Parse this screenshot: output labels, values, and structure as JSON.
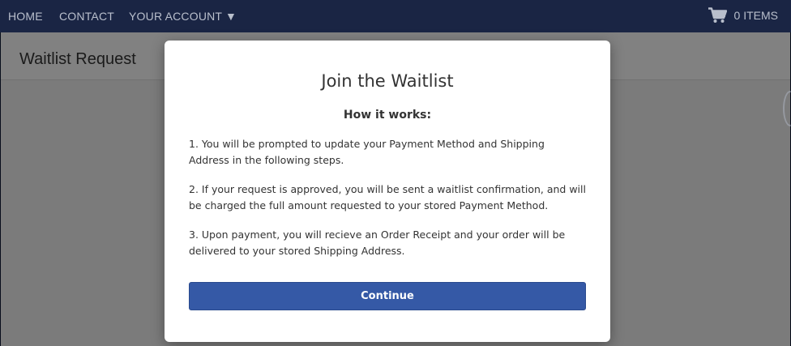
{
  "nav": {
    "home": "HOME",
    "contact": "CONTACT",
    "account": "YOUR ACCOUNT ▼",
    "cart_label": "0 ITEMS",
    "cart_icon": "shopping-cart-icon"
  },
  "page": {
    "title": "Waitlist Request"
  },
  "modal": {
    "title": "Join the Waitlist",
    "subtitle": "How it works:",
    "steps": [
      "1. You will be prompted to update your Payment Method and Shipping Address in the following steps.",
      "2. If your request is approved, you will be sent a waitlist confirmation, and will be charged the full amount requested to your stored Payment Method.",
      "3. Upon payment, you will recieve an Order Receipt and your order will be delivered to your stored Shipping Address."
    ],
    "continue_label": "Continue"
  },
  "colors": {
    "nav_bg": "#1a2544",
    "nav_text": "#b9bfcc",
    "button_bg": "#3559a6",
    "modal_bg": "#ffffff"
  }
}
